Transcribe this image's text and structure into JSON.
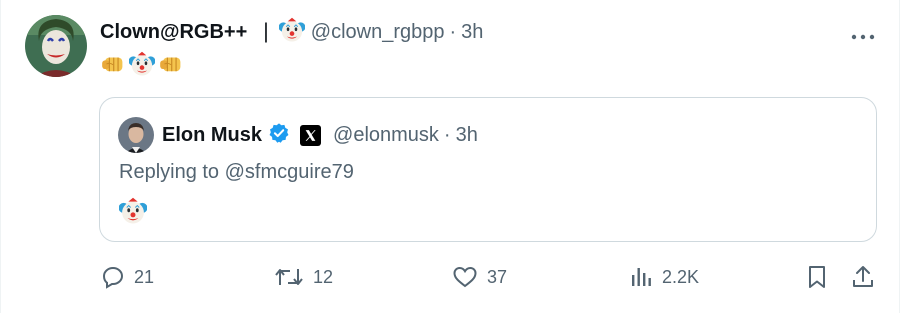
{
  "author": {
    "display_name": "Clown@RGB++",
    "handle": "@clown_rgbpp",
    "time": "3h",
    "separator": "|",
    "dot": "·"
  },
  "tweet": {
    "emojis": [
      "fist-emoji",
      "clown-emoji",
      "fist-emoji"
    ]
  },
  "quote": {
    "display_name": "Elon Musk",
    "handle": "@elonmusk",
    "time": "3h",
    "dot": "·",
    "reply_prefix": "Replying to ",
    "reply_target": "@sfmcguire79",
    "emoji": "clown-emoji"
  },
  "actions": {
    "replies": "21",
    "reposts": "12",
    "likes": "37",
    "views": "2.2K"
  },
  "colors": {
    "text": "#0f1419",
    "secondary": "#536471",
    "border": "#cfd9de",
    "verified": "#1d9bf0"
  },
  "icons": [
    "reply-icon",
    "repost-icon",
    "like-icon",
    "views-icon",
    "bookmark-icon",
    "share-icon",
    "more-icon",
    "verified-icon",
    "x-logo-icon"
  ]
}
